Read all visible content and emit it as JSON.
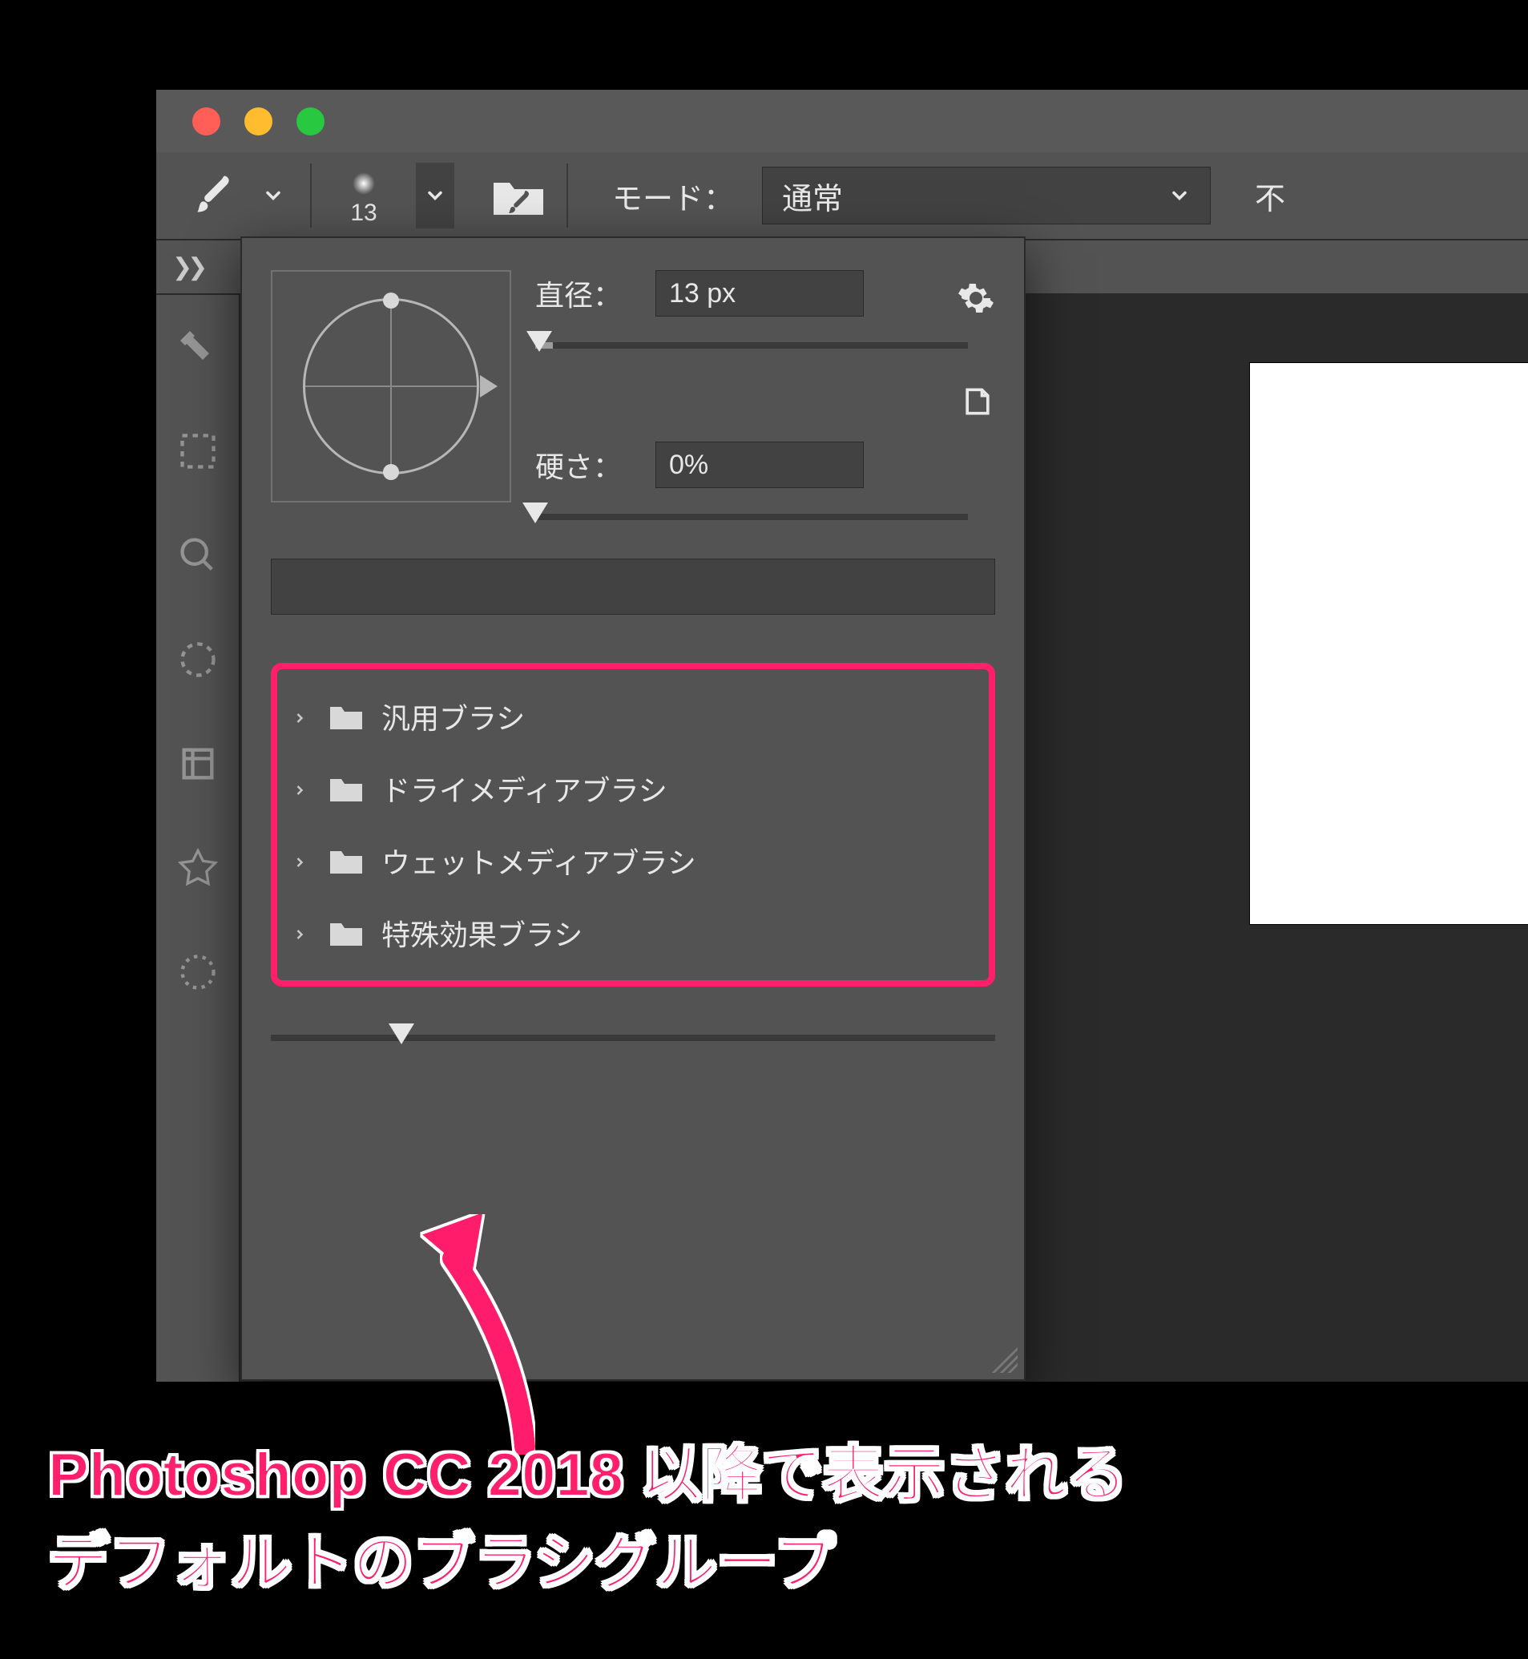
{
  "options_bar": {
    "brush_size_text": "13",
    "mode_label": "モード：",
    "mode_value": "通常",
    "trailing": "不"
  },
  "brush_picker": {
    "diameter_label": "直径：",
    "diameter_value": "13 px",
    "hardness_label": "硬さ：",
    "hardness_value": "0%",
    "folders": [
      {
        "label": "汎用ブラシ"
      },
      {
        "label": "ドライメディアブラシ"
      },
      {
        "label": "ウェットメディアブラシ"
      },
      {
        "label": "特殊効果ブラシ"
      }
    ]
  },
  "annotation": {
    "line1": "Photoshop CC 2018 以降で表示される",
    "line2": "デフォルトのブラシグループ"
  }
}
